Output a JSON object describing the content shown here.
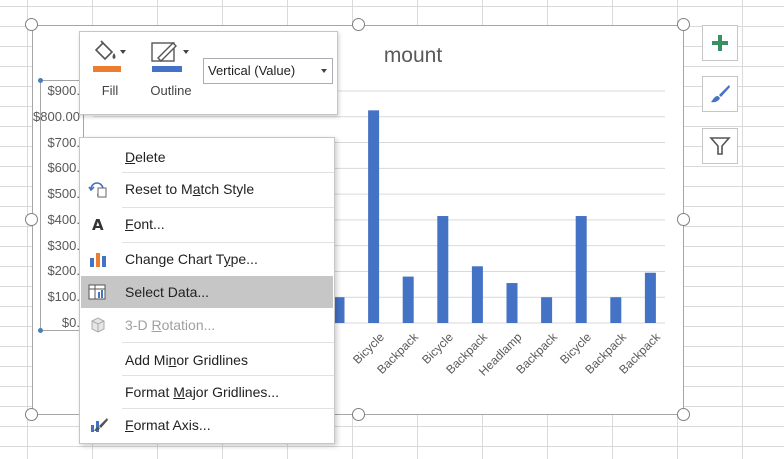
{
  "chart": {
    "title_visible": "mount",
    "bar_color": "#4472c4"
  },
  "chart_data": {
    "type": "bar",
    "title": "mount",
    "y_tick_labels": [
      "$0.",
      "$100.",
      "$200.",
      "$300.",
      "$400.",
      "$500.",
      "$600.",
      "$700.",
      "$800.00",
      "$900."
    ],
    "ylim": [
      0,
      900
    ],
    "grid": true,
    "visible_categories": [
      "Bicycle",
      "Backpack",
      "Bicycle",
      "Backpack",
      "Headlamp",
      "Backpack",
      "Bicycle",
      "Backpack",
      "Backpack"
    ],
    "values": [
      100,
      825,
      180,
      415,
      220,
      155,
      100,
      415,
      100,
      195
    ]
  },
  "mini_toolbar": {
    "fill_label": "Fill",
    "outline_label": "Outline",
    "selector_value": "Vertical (Value)",
    "fill_color": "#ed7d31",
    "outline_color": "#4472c4"
  },
  "context_menu": {
    "items": [
      {
        "pre": "",
        "u": "D",
        "post": "elete",
        "icon": "none",
        "enabled": true
      },
      {
        "pre": "Reset to M",
        "u": "a",
        "post": "tch Style",
        "icon": "reset-style-icon",
        "enabled": true
      },
      {
        "pre": "",
        "u": "F",
        "post": "ont...",
        "icon": "font-icon",
        "enabled": true
      },
      {
        "pre": "Change Chart T",
        "u": "y",
        "post": "pe...",
        "icon": "chart-type-icon",
        "enabled": true
      },
      {
        "pre": "Select Data...",
        "u": "",
        "post": "",
        "icon": "select-data-icon",
        "enabled": true,
        "highlighted": true
      },
      {
        "pre": "3-D ",
        "u": "R",
        "post": "otation...",
        "icon": "cube-icon",
        "enabled": false
      },
      {
        "pre": "Add Mi",
        "u": "n",
        "post": "or Gridlines",
        "icon": "none",
        "enabled": true
      },
      {
        "pre": "Format ",
        "u": "M",
        "post": "ajor Gridlines...",
        "icon": "none",
        "enabled": true
      },
      {
        "pre": "",
        "u": "F",
        "post": "ormat Axis...",
        "icon": "format-axis-icon",
        "enabled": true
      }
    ]
  },
  "side_tools": {
    "icons": [
      "chart-elements-plus-icon",
      "chart-styles-brush-icon",
      "chart-filters-funnel-icon"
    ]
  }
}
